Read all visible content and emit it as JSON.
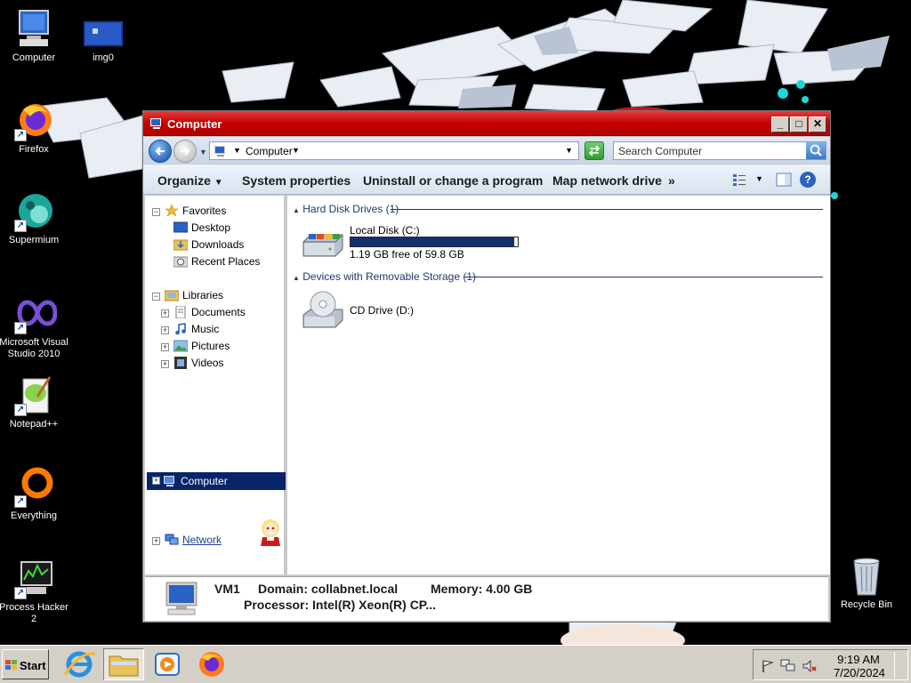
{
  "desktop": {
    "icons": [
      {
        "label": "Computer"
      },
      {
        "label": "img0"
      },
      {
        "label": "Firefox"
      },
      {
        "label": "Supermium"
      },
      {
        "label": "Microsoft Visual Studio 2010"
      },
      {
        "label": "Notepad++"
      },
      {
        "label": "Everything"
      },
      {
        "label": "Process Hacker 2"
      },
      {
        "label": "Recycle Bin"
      }
    ]
  },
  "window": {
    "title": "Computer",
    "address": "Computer",
    "search_placeholder": "Search Computer",
    "commands": {
      "organize": "Organize",
      "system_properties": "System properties",
      "uninstall": "Uninstall or change a program",
      "map_drive": "Map network drive",
      "more": "»"
    },
    "nav": {
      "favorites": "Favorites",
      "desktop": "Desktop",
      "downloads": "Downloads",
      "recent": "Recent Places",
      "libraries": "Libraries",
      "documents": "Documents",
      "music": "Music",
      "pictures": "Pictures",
      "videos": "Videos",
      "computer": "Computer",
      "network": "Network"
    },
    "content": {
      "hdd_group": "Hard Disk Drives (1)",
      "removable_group": "Devices with Removable Storage (1)",
      "local_disk": {
        "name": "Local Disk (C:)",
        "free_text": "1.19 GB free of 59.8 GB",
        "used_fraction": 0.98
      },
      "cd_drive": {
        "name": "CD Drive (D:)"
      }
    },
    "details": {
      "name": "VM1",
      "domain": "Domain: collabnet.local",
      "memory": "Memory: 4.00 GB",
      "processor": "Processor: Intel(R) Xeon(R) CP..."
    }
  },
  "taskbar": {
    "start": "Start",
    "time": "9:19 AM",
    "date": "7/20/2024"
  },
  "colors": {
    "title_bar": "#c40000",
    "selection": "#0a246a",
    "progress_fill": "#12306e",
    "group_header": "#1e3a6b"
  }
}
